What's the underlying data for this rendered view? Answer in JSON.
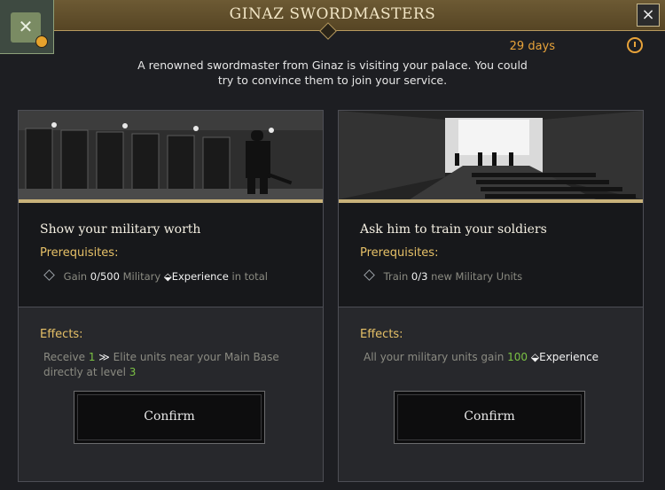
{
  "header": {
    "title": "GINAZ SWORDMASTERS"
  },
  "timer": {
    "label": "29 days"
  },
  "description": "A renowned swordmaster from Ginaz is visiting your palace. You could try to convince them to join your service.",
  "colors": {
    "accent_gold": "#e6c067",
    "highlight_green": "#7bc244",
    "timer_orange": "#e8a33a"
  },
  "icons": [
    "military-emblem-icon",
    "close-icon",
    "stopwatch-icon",
    "diamond-icon",
    "elite-unit-icon",
    "experience-icon"
  ],
  "cards": [
    {
      "title": "Show your military worth",
      "prereq_label": "Prerequisites:",
      "prereq": {
        "pre": "Gain",
        "current": "0",
        "sep": "/",
        "target": "500",
        "unit": "Military",
        "resource": "Experience",
        "post": "in total"
      },
      "effects_label": "Effects:",
      "effects": {
        "pre": "Receive",
        "count": "1",
        "text": "Elite units near your Main Base directly at level",
        "level": "3"
      },
      "confirm_label": "Confirm"
    },
    {
      "title": "Ask him to train your soldiers",
      "prereq_label": "Prerequisites:",
      "prereq": {
        "pre": "Train",
        "current": "0",
        "sep": "/",
        "target": "3",
        "unit": "new Military Units"
      },
      "effects_label": "Effects:",
      "effects": {
        "pre": "All your military units gain",
        "amount": "100",
        "resource": "Experience"
      },
      "confirm_label": "Confirm"
    }
  ]
}
